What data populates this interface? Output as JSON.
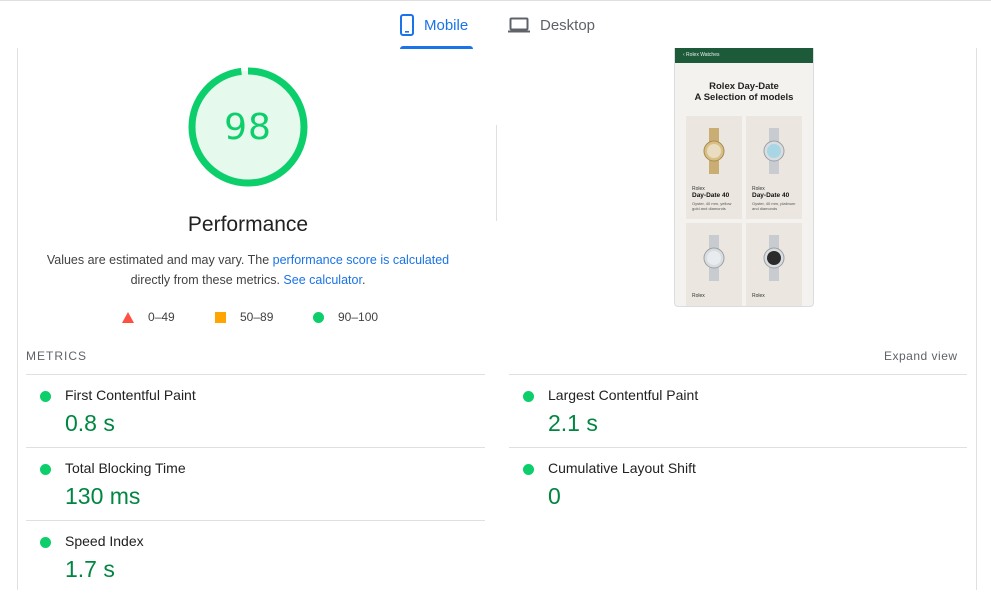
{
  "tabs": [
    {
      "label": "Mobile",
      "icon": "phone-icon",
      "active": true
    },
    {
      "label": "Desktop",
      "icon": "laptop-icon",
      "active": false
    }
  ],
  "performance": {
    "score": "98",
    "score_value": 98,
    "title": "Performance",
    "desc_prefix": "Values are estimated and may vary. The ",
    "desc_link": "performance score is calculated",
    "desc_middle": " directly from these metrics. ",
    "desc_link2": "See calculator",
    "desc_suffix": "."
  },
  "legend": [
    {
      "range": "0–49",
      "color": "#ff4e42",
      "shape": "triangle"
    },
    {
      "range": "50–89",
      "color": "#ffa400",
      "shape": "square"
    },
    {
      "range": "90–100",
      "color": "#0cce6b",
      "shape": "circle"
    }
  ],
  "screenshot": {
    "nav_text": "‹  Rolex Watches",
    "heading_line1": "Rolex Day-Date",
    "heading_line2": "A Selection of models",
    "items": [
      {
        "brand": "Rolex",
        "model": "Day-Date 40",
        "desc": "Oyster, 40 mm, yellow gold and diamonds"
      },
      {
        "brand": "Rolex",
        "model": "Day-Date 40",
        "desc": "Oyster, 40 mm, platinum and diamonds"
      },
      {
        "brand": "Rolex",
        "model": "",
        "desc": ""
      },
      {
        "brand": "Rolex",
        "model": "",
        "desc": ""
      }
    ]
  },
  "metrics": {
    "heading": "METRICS",
    "expand_label": "Expand view",
    "items": [
      {
        "label": "First Contentful Paint",
        "value": "0.8 s",
        "status": "good"
      },
      {
        "label": "Largest Contentful Paint",
        "value": "2.1 s",
        "status": "good"
      },
      {
        "label": "Total Blocking Time",
        "value": "130 ms",
        "status": "good"
      },
      {
        "label": "Cumulative Layout Shift",
        "value": "0",
        "status": "good"
      },
      {
        "label": "Speed Index",
        "value": "1.7 s",
        "status": "good"
      }
    ]
  },
  "colors": {
    "good": "#0cce6b",
    "good_text": "#018642",
    "accent": "#1a73e8"
  }
}
